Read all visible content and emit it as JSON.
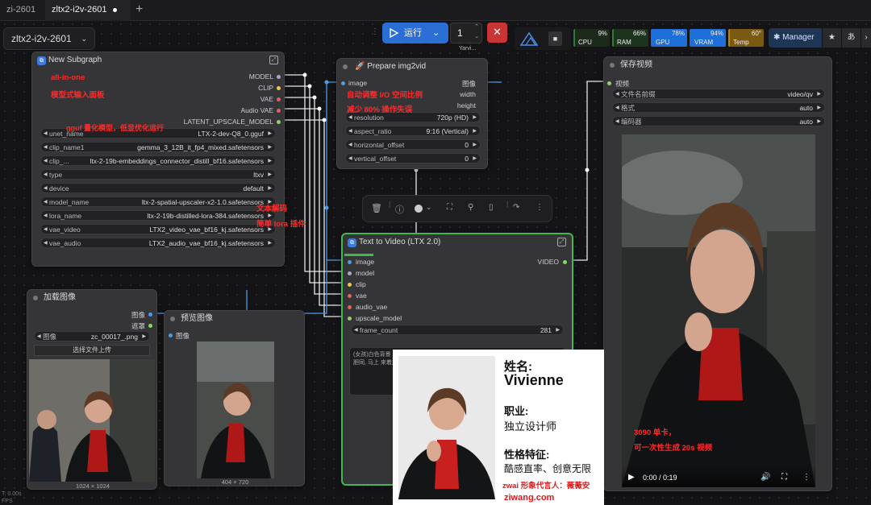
{
  "tabs": [
    {
      "label": "zi-2601"
    },
    {
      "label": "zltx2-i2v-2601"
    }
  ],
  "new_tab_label": "+",
  "workflow_selector": {
    "label": "zltx2-i2v-2601",
    "chevron": "chevron-down-icon"
  },
  "toolbar": {
    "run_label": "运行",
    "queue_count": "1",
    "yarvis_label": "Yarvi...",
    "stop_icon": "close-icon"
  },
  "stats": [
    {
      "label": "CPU",
      "value": "9%",
      "color": "#2e7d32"
    },
    {
      "label": "RAM",
      "value": "66%",
      "color": "#2e7d32"
    },
    {
      "label": "GPU",
      "value": "78%",
      "color": "#1e6fd9"
    },
    {
      "label": "VRAM",
      "value": "94%",
      "color": "#1e6fd9"
    },
    {
      "label": "Temp",
      "value": "60°",
      "color": "#b8860b"
    }
  ],
  "manager_label": "Manager",
  "subgraph": {
    "title": "New Subgraph",
    "outputs": [
      "MODEL",
      "CLIP",
      "VAE",
      "Audio VAE",
      "LATENT_UPSCALE_MODEL"
    ],
    "widgets": [
      {
        "label": "unet_name",
        "value": "LTX-2-dev-Q8_0.gguf"
      },
      {
        "label": "clip_name1",
        "value": "gemma_3_12B_it_fp4_mixed.safetensors"
      },
      {
        "label": "clip_...",
        "value": "ltx-2-19b-embeddings_connector_distill_bf16.safetensors"
      },
      {
        "label": "type",
        "value": "ltxv"
      },
      {
        "label": "device",
        "value": "default"
      },
      {
        "label": "model_name",
        "value": "ltx-2-spatial-upscaler-x2-1.0.safetensors"
      },
      {
        "label": "lora_name",
        "value": "ltx-2-19b-distilled-lora-384.safetensors"
      },
      {
        "label": "vae_video",
        "value": "LTX2_video_vae_bf16_kj.safetensors"
      },
      {
        "label": "vae_audio",
        "value": "LTX2_audio_vae_bf16_kj.safetensors"
      }
    ]
  },
  "annotations": {
    "allinone": "all-in-one",
    "embed": "模型式输入面板",
    "gguf": "gguf 量化模型，低显优化运行",
    "prep1": "自动调整 I/O 空间比例",
    "prep2": "减少 80% 操作失误",
    "lora1": "文本解码",
    "lora2": "简单 lora 插件",
    "gpu1": "3090 单卡，",
    "gpu2": "可一次性生成 20s 视频"
  },
  "prepare": {
    "title": "Prepare img2vid",
    "input": "image",
    "outputs": [
      "图像",
      "width",
      "height"
    ],
    "widgets": [
      {
        "label": "resolution",
        "value": "720p (HD)"
      },
      {
        "label": "aspect_ratio",
        "value": "9:16 (Vertical)"
      },
      {
        "label": "horizontal_offset",
        "value": "0"
      },
      {
        "label": "vertical_offset",
        "value": "0"
      }
    ]
  },
  "t2v": {
    "title": "Text to Video (LTX 2.0)",
    "inputs": [
      "image",
      "model",
      "clip",
      "vae",
      "audio_vae",
      "upscale_model"
    ],
    "output": "VIDEO",
    "frame_label": "frame_count",
    "frame_value": "281",
    "prompt": "(女孩)白色背景 主体 \"金雕\"直面跟, 驱使 着衣冠, 雄姿鹰 为冯洛骂喝, 打逆 行, 我大胆同, 马上 来着来, 马上 二家..."
  },
  "save": {
    "title": "保存视频",
    "input": "视频",
    "widgets": [
      {
        "label": "文件名前缀",
        "value": "video/qv"
      },
      {
        "label": "格式",
        "value": "auto"
      },
      {
        "label": "编码器",
        "value": "auto"
      }
    ],
    "time": "0:00 / 0:19"
  },
  "load": {
    "title": "加载图像",
    "outputs": [
      "图像",
      "遮罩"
    ],
    "image_label": "图像",
    "image_value": "zc_00017_.png",
    "upload": "选择文件上传",
    "size": "1024 × 1024"
  },
  "preview": {
    "title": "预览图像",
    "input": "图像",
    "size": "404 × 720"
  },
  "card": {
    "name_label": "姓名:",
    "name": "Vivienne",
    "job_label": "职业:",
    "job": "独立设计师",
    "trait_label": "性格特征:",
    "traits": "酷感直率、创意无限",
    "spokes": "zwai 形象代言人：薇薇安",
    "site": "ziwang.com"
  },
  "footer": {
    "t1": "T: 0.00s",
    "t2": "FPS"
  }
}
